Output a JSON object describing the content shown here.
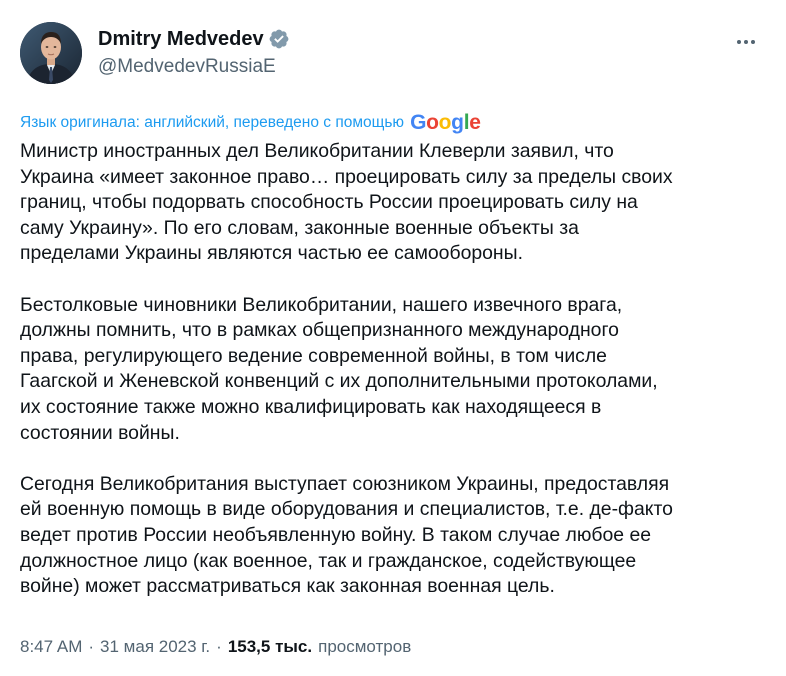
{
  "author": {
    "name": "Dmitry Medvedev",
    "handle": "@MedvedevRussiaE"
  },
  "translation": {
    "note": "Язык оригинала: английский, переведено с помощью",
    "provider": "Google"
  },
  "paragraphs": [
    "Министр иностранных дел Великобритании Клеверли заявил, что\nУкраина «имеет законное право… проецировать силу за пределы своих\nграниц, чтобы подорвать способность России проецировать силу на\nсаму Украину». По его словам, законные военные объекты за\nпределами Украины являются частью ее самообороны.",
    "Бестолковые чиновники Великобритании, нашего извечного врага,\nдолжны помнить, что в рамках общепризнанного международного\nправа, регулирующего ведение современной войны, в том числе\nГаагской и Женевской конвенций с их дополнительными протоколами,\nих состояние также можно квалифицировать как находящееся в\nсостоянии войны.",
    "Сегодня Великобритания выступает союзником Украины, предоставляя\nей военную помощь в виде оборудования и специалистов, т.е. де-факто\nведет против России необъявленную войну. В таком случае любое ее\nдолжностное лицо (как военное, так и гражданское, содействующее\nвойне) может рассматриваться как законная военная цель."
  ],
  "meta": {
    "time": "8:47 AM",
    "sep1": "·",
    "date": "31 мая 2023 г.",
    "sep2": "·",
    "views_count": "153,5 тыс.",
    "views_label": "просмотров"
  },
  "icons": {
    "verified": "verified-badge-icon",
    "more": "more-options-icon"
  },
  "colors": {
    "link": "#1d9bf0",
    "secondary_text": "#536471",
    "primary_text": "#0f1419",
    "verified_badge": "#829aab"
  }
}
